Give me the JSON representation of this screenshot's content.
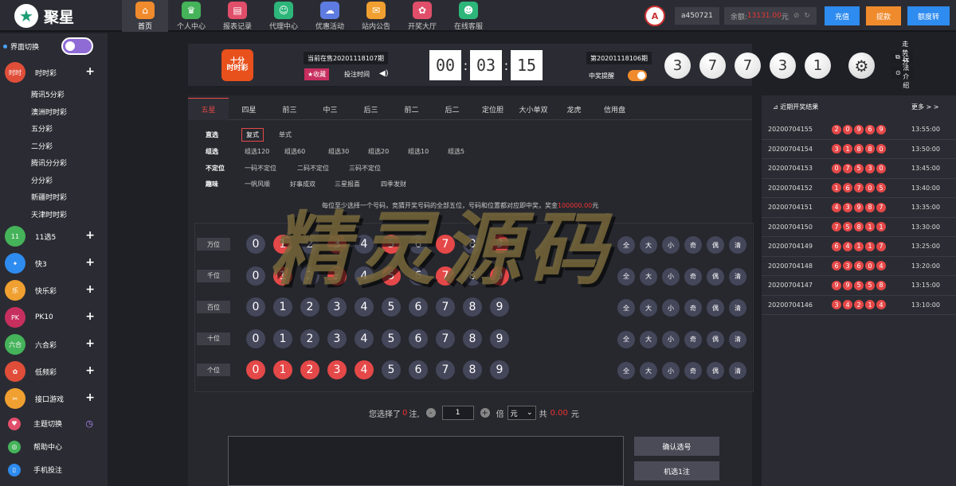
{
  "logo": {
    "text": "聚星"
  },
  "nav": [
    {
      "label": "首页",
      "color": "#f08b2d",
      "icon": "⌂"
    },
    {
      "label": "个人中心",
      "color": "#45b35a",
      "icon": "♛"
    },
    {
      "label": "报表记录",
      "color": "#e04e6a",
      "icon": "▤"
    },
    {
      "label": "代理中心",
      "color": "#2db67a",
      "icon": "☺"
    },
    {
      "label": "优惠活动",
      "color": "#5d7be0",
      "icon": "☁"
    },
    {
      "label": "站内公告",
      "color": "#f0a030",
      "icon": "✉"
    },
    {
      "label": "开奖大厅",
      "color": "#e04e6a",
      "icon": "✿"
    },
    {
      "label": "在线客服",
      "color": "#2db67a",
      "icon": "☻"
    }
  ],
  "user": {
    "avatar": "A",
    "name": "a450721",
    "balance_label": "余额:",
    "balance": "13131.00",
    "balance_unit": "元"
  },
  "top_buttons": [
    {
      "label": "充值",
      "color": "#2e8bef"
    },
    {
      "label": "提款",
      "color": "#f08b2d"
    },
    {
      "label": "额度转",
      "color": "#2e8bef"
    }
  ],
  "sidebar": {
    "switch_label": "界面切换",
    "categories": [
      {
        "label": "时时彩",
        "color": "#e04e3a",
        "icon": "时时"
      },
      {
        "label": "11选5",
        "color": "#45b35a",
        "icon": "11"
      },
      {
        "label": "快3",
        "color": "#2e8bef",
        "icon": "✦"
      },
      {
        "label": "快乐彩",
        "color": "#f0a030",
        "icon": "乐"
      },
      {
        "label": "PK10",
        "color": "#c72f5f",
        "icon": "PK"
      },
      {
        "label": "六合彩",
        "color": "#45b35a",
        "icon": "六合"
      },
      {
        "label": "低频彩",
        "color": "#e04e3a",
        "icon": "✿"
      },
      {
        "label": "接口游戏",
        "color": "#f0a030",
        "icon": "✂"
      }
    ],
    "subitems": [
      "腾讯5分彩",
      "澳洲时时彩",
      "五分彩",
      "二分彩",
      "腾讯分分彩",
      "分分彩",
      "新疆时时彩",
      "天津时时彩"
    ],
    "bottom": [
      {
        "label": "主题切换",
        "color": "#e04e6a",
        "icon": "♥"
      },
      {
        "label": "帮助中心",
        "color": "#45b35a",
        "icon": "◎"
      },
      {
        "label": "手机投注",
        "color": "#2e8bef",
        "icon": "▯"
      }
    ]
  },
  "lottery": {
    "logo_text": "十分\n时时彩",
    "current_issue": "当前在售20201118107期",
    "fav": "★收藏",
    "deadline": "投注时间",
    "timer": [
      "00",
      "03",
      "15"
    ],
    "last_issue": "第20201118106期",
    "notify": "中奖提醒",
    "result": [
      "3",
      "7",
      "7",
      "3",
      "1"
    ],
    "trend": "走势分析",
    "howto": "玩法介绍"
  },
  "tabs": [
    "五星",
    "四星",
    "前三",
    "中三",
    "后三",
    "前二",
    "后二",
    "定位胆",
    "大小单双",
    "龙虎",
    "信用盘"
  ],
  "playrows": [
    {
      "label": "直选",
      "options": [
        "复式",
        "单式"
      ]
    },
    {
      "label": "组选",
      "options": [
        "组选120",
        "组选60",
        "组选30",
        "组选20",
        "组选10",
        "组选5"
      ]
    },
    {
      "label": "不定位",
      "options": [
        "一码不定位",
        "二码不定位",
        "三码不定位"
      ]
    },
    {
      "label": "趣味",
      "options": [
        "一帆风顺",
        "好事成双",
        "三星报喜",
        "四季发财"
      ]
    }
  ],
  "hint": {
    "text": "每位至少选择一个号码，竞猜开奖号码的全部五位，号码和位置都对应即中奖，奖金",
    "amount": "100000.00",
    "unit": "元"
  },
  "positions": [
    {
      "label": "万位",
      "selected": [
        1,
        3,
        5,
        7,
        9
      ]
    },
    {
      "label": "千位",
      "selected": [
        1,
        3,
        5,
        7,
        9
      ]
    },
    {
      "label": "百位",
      "selected": []
    },
    {
      "label": "十位",
      "selected": []
    },
    {
      "label": "个位",
      "selected": [
        0,
        1,
        2,
        3,
        4
      ]
    }
  ],
  "digits": [
    "0",
    "1",
    "2",
    "3",
    "4",
    "5",
    "6",
    "7",
    "8",
    "9"
  ],
  "quick": [
    "全",
    "大",
    "小",
    "奇",
    "偶",
    "清"
  ],
  "summary": {
    "prefix": "您选择了",
    "count": "0",
    "unit": "注,",
    "multiple": "1",
    "times": "倍",
    "mode": "元",
    "total_label": "共",
    "total": "0.00",
    "yuan": "元"
  },
  "actions": [
    "确认选号",
    "机选1注"
  ],
  "recent": {
    "title": "近期开奖结果",
    "more": "更多 > >",
    "rows": [
      {
        "issue": "20200704155",
        "nums": [
          "2",
          "0",
          "9",
          "6",
          "9"
        ],
        "time": "13:55:00"
      },
      {
        "issue": "20200704154",
        "nums": [
          "3",
          "1",
          "8",
          "8",
          "0"
        ],
        "time": "13:50:00"
      },
      {
        "issue": "20200704153",
        "nums": [
          "0",
          "7",
          "5",
          "3",
          "0"
        ],
        "time": "13:45:00"
      },
      {
        "issue": "20200704152",
        "nums": [
          "1",
          "6",
          "7",
          "0",
          "5"
        ],
        "time": "13:40:00"
      },
      {
        "issue": "20200704151",
        "nums": [
          "4",
          "3",
          "9",
          "8",
          "7"
        ],
        "time": "13:35:00"
      },
      {
        "issue": "20200704150",
        "nums": [
          "7",
          "5",
          "8",
          "1",
          "1"
        ],
        "time": "13:30:00"
      },
      {
        "issue": "20200704149",
        "nums": [
          "6",
          "4",
          "1",
          "1",
          "7"
        ],
        "time": "13:25:00"
      },
      {
        "issue": "20200704148",
        "nums": [
          "6",
          "3",
          "6",
          "0",
          "4"
        ],
        "time": "13:20:00"
      },
      {
        "issue": "20200704147",
        "nums": [
          "9",
          "9",
          "5",
          "5",
          "8"
        ],
        "time": "13:15:00"
      },
      {
        "issue": "20200704146",
        "nums": [
          "3",
          "4",
          "2",
          "1",
          "4"
        ],
        "time": "13:10:00"
      }
    ]
  },
  "watermark": "精灵源码"
}
